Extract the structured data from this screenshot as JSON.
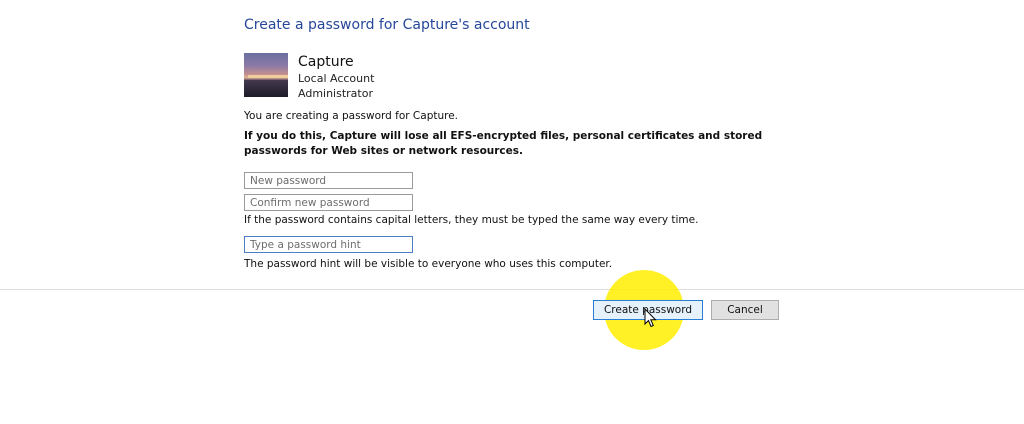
{
  "dialog": {
    "title": "Create a password for Capture's account"
  },
  "account": {
    "name": "Capture",
    "type": "Local Account",
    "role": "Administrator"
  },
  "messages": {
    "intro": "You are creating a password for Capture.",
    "warning": "If you do this, Capture will lose all EFS-encrypted files, personal certificates and stored passwords for Web sites or network resources.",
    "case_note": "If the password contains capital letters, they must be typed the same way every time.",
    "hint_note": "The password hint will be visible to everyone who uses this computer."
  },
  "fields": {
    "new_password": {
      "placeholder": "New password",
      "value": ""
    },
    "confirm_password": {
      "placeholder": "Confirm new password",
      "value": ""
    },
    "hint": {
      "placeholder": "Type a password hint",
      "value": ""
    }
  },
  "buttons": {
    "create": "Create password",
    "cancel": "Cancel"
  },
  "colors": {
    "title": "#26479a",
    "highlight": "#ffee00",
    "focus_border": "#2a7fd4"
  }
}
